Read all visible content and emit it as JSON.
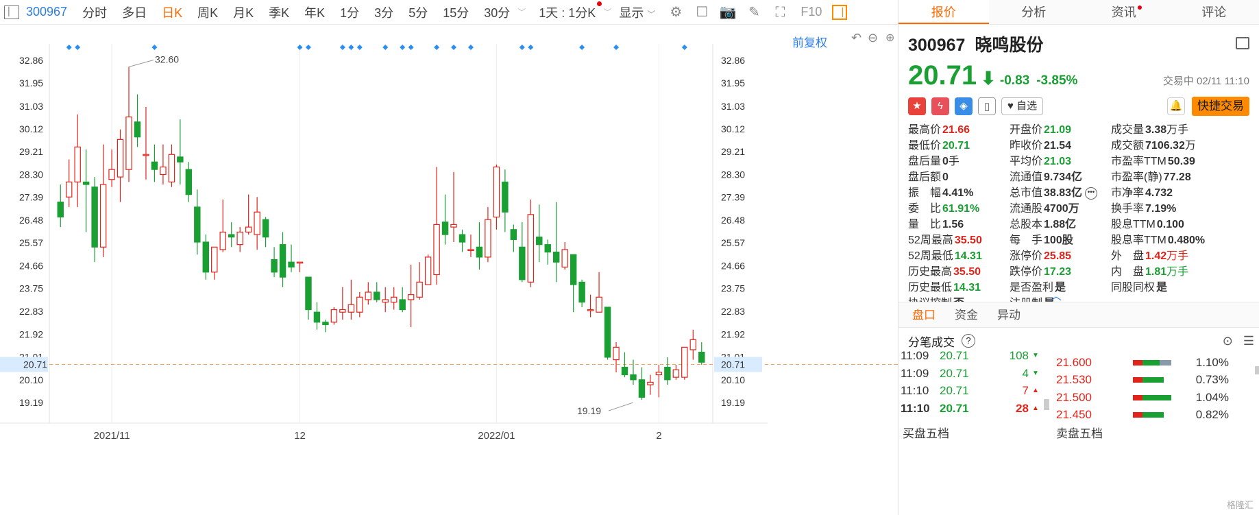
{
  "toolbar": {
    "code": "300967",
    "periods": [
      "分时",
      "多日",
      "日K",
      "周K",
      "月K",
      "季K",
      "年K",
      "1分",
      "3分",
      "5分",
      "15分",
      "30分"
    ],
    "active_period": "日K",
    "interval_label": "1天 : 1分K",
    "display_label": "显示",
    "f10_label": "F10"
  },
  "chart": {
    "fuquan_label": "前复权",
    "price_line": "20.71",
    "high_mark": "32.60",
    "low_mark": "19.19",
    "colors": {
      "up": "#e2231a",
      "down": "#1a9f33",
      "dash": "#f5a352",
      "diamond": "#2b8ef0",
      "price_tag_bg": "#d9ecff"
    }
  },
  "chart_data": {
    "type": "candlestick",
    "y_ticks": [
      "32.86",
      "31.95",
      "31.03",
      "30.12",
      "29.21",
      "28.30",
      "27.39",
      "26.48",
      "25.57",
      "24.66",
      "23.75",
      "22.83",
      "21.92",
      "21.01",
      "20.10",
      "19.19"
    ],
    "ylim": [
      19.19,
      32.86
    ],
    "x_labels": [
      "2021/11",
      "12",
      "2022/01",
      "2"
    ],
    "x_label_index": [
      6,
      28,
      51,
      70
    ],
    "current_price": 20.71,
    "annotations": [
      {
        "label": "32.60",
        "value": 32.6,
        "index": 8
      },
      {
        "label": "19.19",
        "value": 19.19,
        "index": 67
      }
    ],
    "marker_index": [
      1,
      2,
      11,
      28,
      29,
      33,
      34,
      35,
      38,
      40,
      41,
      44,
      46,
      48,
      54,
      55,
      61,
      65,
      73
    ],
    "candles": [
      [
        27.2,
        26.6,
        26.2,
        27.9
      ],
      [
        27.4,
        28.0,
        27.0,
        28.9
      ],
      [
        28.0,
        29.4,
        27.0,
        30.7
      ],
      [
        28.0,
        27.9,
        26.0,
        29.3
      ],
      [
        27.8,
        25.4,
        24.8,
        28.2
      ],
      [
        25.4,
        27.9,
        25.0,
        29.5
      ],
      [
        28.1,
        28.5,
        27.8,
        29.3
      ],
      [
        28.2,
        29.7,
        27.2,
        30.1
      ],
      [
        28.5,
        30.6,
        28.0,
        32.6
      ],
      [
        30.4,
        29.8,
        29.4,
        31.5
      ],
      [
        29.1,
        29.1,
        28.1,
        31.0
      ],
      [
        28.8,
        28.5,
        28.0,
        29.5
      ],
      [
        28.3,
        28.6,
        27.9,
        29.5
      ],
      [
        28.0,
        29.1,
        27.8,
        29.5
      ],
      [
        29.0,
        28.8,
        27.9,
        30.5
      ],
      [
        28.5,
        27.5,
        27.2,
        28.8
      ],
      [
        27.0,
        25.6,
        25.1,
        27.7
      ],
      [
        25.6,
        24.4,
        24.1,
        25.9
      ],
      [
        24.4,
        25.4,
        24.1,
        25.4
      ],
      [
        25.3,
        26.0,
        25.2,
        27.3
      ],
      [
        25.9,
        25.8,
        25.4,
        26.4
      ],
      [
        25.5,
        26.0,
        25.2,
        26.2
      ],
      [
        26.0,
        26.2,
        25.9,
        27.5
      ],
      [
        25.9,
        26.8,
        25.3,
        27.4
      ],
      [
        26.5,
        25.8,
        25.4,
        26.6
      ],
      [
        24.9,
        24.4,
        24.2,
        25.4
      ],
      [
        25.5,
        24.2,
        23.8,
        26.0
      ],
      [
        24.8,
        24.6,
        24.4,
        25.5
      ],
      [
        24.8,
        24.8,
        24.4,
        24.8
      ],
      [
        24.2,
        22.9,
        22.5,
        24.2
      ],
      [
        22.8,
        22.4,
        22.1,
        23.2
      ],
      [
        22.4,
        22.3,
        22.0,
        22.5
      ],
      [
        22.4,
        22.9,
        22.3,
        23.0
      ],
      [
        22.8,
        22.9,
        22.5,
        23.8
      ],
      [
        22.8,
        23.1,
        22.5,
        24.1
      ],
      [
        22.8,
        23.4,
        22.6,
        23.6
      ],
      [
        23.3,
        23.6,
        23.1,
        24.0
      ],
      [
        23.6,
        23.3,
        23.2,
        24.0
      ],
      [
        23.2,
        23.3,
        22.8,
        23.8
      ],
      [
        23.2,
        23.4,
        22.9,
        23.8
      ],
      [
        23.3,
        22.9,
        22.8,
        23.8
      ],
      [
        23.3,
        23.5,
        22.2,
        24.7
      ],
      [
        23.4,
        24.0,
        23.3,
        24.8
      ],
      [
        23.9,
        25.0,
        23.9,
        25.1
      ],
      [
        24.3,
        26.3,
        23.9,
        28.6
      ],
      [
        26.4,
        25.9,
        25.5,
        27.5
      ],
      [
        26.2,
        26.3,
        25.6,
        28.4
      ],
      [
        25.9,
        25.6,
        25.2,
        26.1
      ],
      [
        25.3,
        25.3,
        25.0,
        25.9
      ],
      [
        25.4,
        25.0,
        24.5,
        26.4
      ],
      [
        25.0,
        26.5,
        24.8,
        27.0
      ],
      [
        26.6,
        28.6,
        26.1,
        28.7
      ],
      [
        28.0,
        26.8,
        26.0,
        28.5
      ],
      [
        26.1,
        25.7,
        25.2,
        26.3
      ],
      [
        25.4,
        24.1,
        24.0,
        26.4
      ],
      [
        24.0,
        26.7,
        23.8,
        27.3
      ],
      [
        25.8,
        25.5,
        24.8,
        27.1
      ],
      [
        25.5,
        25.2,
        24.7,
        25.7
      ],
      [
        25.2,
        24.8,
        24.0,
        27.2
      ],
      [
        24.6,
        25.3,
        24.5,
        25.6
      ],
      [
        25.1,
        23.9,
        22.8,
        25.1
      ],
      [
        24.0,
        23.2,
        23.0,
        24.1
      ],
      [
        22.9,
        22.9,
        22.6,
        23.5
      ],
      [
        22.8,
        23.4,
        22.8,
        24.4
      ],
      [
        23.0,
        21.0,
        20.9,
        23.0
      ],
      [
        20.9,
        21.4,
        20.4,
        21.6
      ],
      [
        20.6,
        20.3,
        20.2,
        21.2
      ],
      [
        20.3,
        20.1,
        19.9,
        20.9
      ],
      [
        20.1,
        19.4,
        19.3,
        20.6
      ],
      [
        19.9,
        20.0,
        19.5,
        20.3
      ],
      [
        20.3,
        20.4,
        19.4,
        20.7
      ],
      [
        20.6,
        20.1,
        19.9,
        21.0
      ],
      [
        20.2,
        20.5,
        20.1,
        20.7
      ],
      [
        20.2,
        21.4,
        20.1,
        21.4
      ],
      [
        21.3,
        21.7,
        20.9,
        22.1
      ],
      [
        21.2,
        20.8,
        20.7,
        21.6
      ]
    ]
  },
  "stock": {
    "code": "300967",
    "name": "晓鸣股份",
    "price": "20.71",
    "arrow": "⬇",
    "change": "-0.83",
    "change_pct": "-3.85%",
    "status": "交易中 02/11 11:10",
    "watch_label": "自选",
    "quick_trade_label": "快捷交易"
  },
  "right_tabs": [
    "报价",
    "分析",
    "资讯",
    "评论"
  ],
  "quote_rows": [
    [
      {
        "label": "最高价",
        "value": "21.66",
        "cls": "up"
      },
      {
        "label": "开盘价",
        "value": "21.09",
        "cls": "down"
      },
      {
        "label": "成交量",
        "value": "3.38",
        "unit": "万手",
        "cls": "flat"
      }
    ],
    [
      {
        "label": "最低价",
        "value": "20.71",
        "cls": "down"
      },
      {
        "label": "昨收价",
        "value": "21.54",
        "cls": "flat"
      },
      {
        "label": "成交额",
        "value": "7106.32",
        "unit": "万",
        "cls": "flat"
      }
    ],
    [
      {
        "label": "盘后量",
        "value": "0",
        "unit": "手",
        "cls": "flat"
      },
      {
        "label": "平均价",
        "value": "21.03",
        "cls": "down"
      },
      {
        "label": "市盈率TTM",
        "value": "50.39",
        "cls": "flat"
      }
    ],
    [
      {
        "label": "盘后额",
        "value": "0",
        "cls": "flat"
      },
      {
        "label": "流通值",
        "value": "9.734亿",
        "cls": "flat"
      },
      {
        "label": "市盈率(静)",
        "value": "77.28",
        "cls": "flat"
      }
    ],
    [
      {
        "label": "振　幅",
        "value": "4.41%",
        "cls": "flat"
      },
      {
        "label": "总市值",
        "value": "38.83亿",
        "cls": "flat",
        "more": true
      },
      {
        "label": "市净率",
        "value": "4.732",
        "cls": "flat"
      }
    ],
    [
      {
        "label": "委　比",
        "value": "61.91%",
        "cls": "down"
      },
      {
        "label": "流通股",
        "value": "4700万",
        "cls": "flat"
      },
      {
        "label": "换手率",
        "value": "7.19%",
        "cls": "flat"
      }
    ],
    [
      {
        "label": "量　比",
        "value": "1.56",
        "cls": "flat"
      },
      {
        "label": "总股本",
        "value": "1.88亿",
        "cls": "flat"
      },
      {
        "label": "股息TTM",
        "value": "0.100",
        "cls": "flat"
      }
    ],
    [
      {
        "label": "52周最高",
        "value": "35.50",
        "cls": "up"
      },
      {
        "label": "每　手",
        "value": "100股",
        "cls": "flat"
      },
      {
        "label": "股息率TTM",
        "value": "0.480%",
        "cls": "flat"
      }
    ],
    [
      {
        "label": "52周最低",
        "value": "14.31",
        "cls": "down"
      },
      {
        "label": "涨停价",
        "value": "25.85",
        "cls": "up"
      },
      {
        "label": "外　盘",
        "value": "1.42",
        "unit": "万手",
        "cls": "up"
      }
    ],
    [
      {
        "label": "历史最高",
        "value": "35.50",
        "cls": "up"
      },
      {
        "label": "跌停价",
        "value": "17.23",
        "cls": "down"
      },
      {
        "label": "内　盘",
        "value": "1.81",
        "unit": "万手",
        "cls": "down"
      }
    ],
    [
      {
        "label": "历史最低",
        "value": "14.31",
        "cls": "down"
      },
      {
        "label": "是否盈利",
        "value": "是",
        "cls": "flat"
      },
      {
        "label": "同股同权",
        "value": "是",
        "cls": "flat"
      }
    ],
    [
      {
        "label": "协议控制",
        "value": "否",
        "cls": "flat"
      },
      {
        "label": "注册制",
        "value": "是",
        "cls": "flat"
      },
      {
        "label": "",
        "value": "",
        "cls": "flat"
      }
    ]
  ],
  "bottom_tabs": [
    "盘口",
    "资金",
    "异动"
  ],
  "fenbi_title": "分笔成交",
  "ticks": [
    {
      "time": "11:09",
      "price": "20.71",
      "vol": "108",
      "dir": "down"
    },
    {
      "time": "11:09",
      "price": "20.71",
      "vol": "4",
      "dir": "down"
    },
    {
      "time": "11:10",
      "price": "20.71",
      "vol": "7",
      "dir": "up"
    },
    {
      "time": "11:10",
      "price": "20.71",
      "vol": "28",
      "dir": "up"
    }
  ],
  "levels": [
    {
      "price": "21.600",
      "pct": "1.10%",
      "r": 0.25,
      "g": 0.45,
      "gray": 0.3
    },
    {
      "price": "21.530",
      "pct": "0.73%",
      "r": 0.25,
      "g": 0.55
    },
    {
      "price": "21.500",
      "pct": "1.04%",
      "r": 0.25,
      "g": 0.75
    },
    {
      "price": "21.450",
      "pct": "0.82%",
      "r": 0.25,
      "g": 0.55
    }
  ],
  "buy_five": "买盘五档",
  "sell_five": "卖盘五档",
  "watermark": "格隆汇"
}
